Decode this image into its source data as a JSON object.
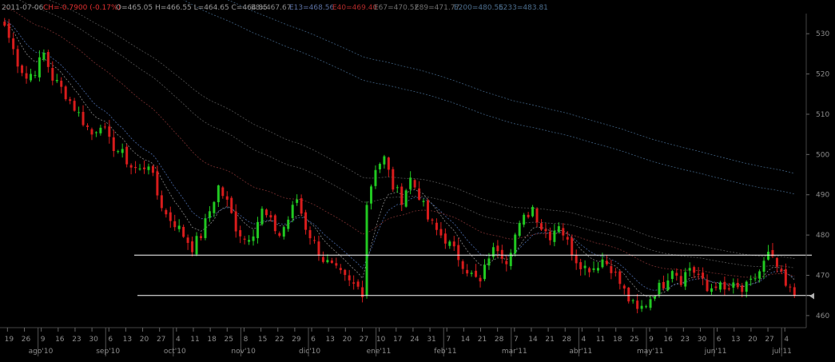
{
  "header": {
    "date": "2011-07-06",
    "change": "CH=-0.7900 (-0.17%)",
    "ohlc": "O=465.05 H=466.55 L=464.65 C=464.85",
    "e8": "E8=467.67",
    "e13": "E13=468.56",
    "e40": "E40=469.40",
    "e67": "E67=470.52",
    "e89": "E89=471.77",
    "e200": "E200=480.55",
    "e233": "E233=483.81"
  },
  "chart_data": {
    "type": "candlestick",
    "ylim": [
      457,
      535
    ],
    "y_ticks": [
      460,
      470,
      480,
      490,
      500,
      510,
      520,
      530
    ],
    "x_day_ticks": [
      "19",
      "26",
      "9",
      "16",
      "23",
      "30",
      "6",
      "13",
      "20",
      "27",
      "4",
      "11",
      "18",
      "25",
      "8",
      "15",
      "22",
      "29",
      "6",
      "13",
      "20",
      "27",
      "10",
      "17",
      "24",
      "31",
      "7",
      "14",
      "21",
      "28",
      "7",
      "14",
      "21",
      "28",
      "4",
      "11",
      "18",
      "25",
      "9",
      "16",
      "23",
      "30",
      "6",
      "13",
      "20",
      "27",
      "4"
    ],
    "x_month_labels": [
      "ago'10",
      "sep'10",
      "oct'10",
      "nov'10",
      "dic'10",
      "ene'11",
      "feb'11",
      "mar'11",
      "abr'11",
      "may'11",
      "jun'11",
      "jul'11"
    ],
    "x_month_tick_index": [
      2,
      6,
      10,
      14,
      18,
      22,
      26,
      30,
      34,
      38,
      42,
      46
    ],
    "last_price": 464.85,
    "horizontal_lines": [
      475,
      465
    ],
    "close_path": [
      [
        0,
        532
      ],
      [
        3,
        523
      ],
      [
        5,
        519
      ],
      [
        7,
        521
      ],
      [
        9,
        525
      ],
      [
        11,
        519
      ],
      [
        14,
        515
      ],
      [
        17,
        510
      ],
      [
        20,
        505
      ],
      [
        22,
        508
      ],
      [
        24,
        503
      ],
      [
        27,
        500
      ],
      [
        29,
        497
      ],
      [
        31,
        496
      ],
      [
        33,
        498
      ],
      [
        35,
        490
      ],
      [
        37,
        485
      ],
      [
        39,
        483
      ],
      [
        41,
        480
      ],
      [
        43,
        477
      ],
      [
        45,
        480
      ],
      [
        47,
        486
      ],
      [
        49,
        492
      ],
      [
        51,
        488
      ],
      [
        53,
        482
      ],
      [
        55,
        479
      ],
      [
        57,
        481
      ],
      [
        59,
        486
      ],
      [
        61,
        483
      ],
      [
        63,
        480
      ],
      [
        65,
        484
      ],
      [
        67,
        489
      ],
      [
        69,
        482
      ],
      [
        71,
        478
      ],
      [
        73,
        474
      ],
      [
        75,
        472
      ],
      [
        77,
        470
      ],
      [
        79,
        468
      ],
      [
        81,
        467
      ],
      [
        82,
        466
      ],
      [
        83,
        488
      ],
      [
        85,
        497
      ],
      [
        87,
        499
      ],
      [
        89,
        492
      ],
      [
        91,
        489
      ],
      [
        93,
        494
      ],
      [
        95,
        490
      ],
      [
        97,
        484
      ],
      [
        99,
        481
      ],
      [
        101,
        479
      ],
      [
        103,
        476
      ],
      [
        105,
        473
      ],
      [
        107,
        470
      ],
      [
        109,
        468
      ],
      [
        111,
        475
      ],
      [
        113,
        477
      ],
      [
        115,
        474
      ],
      [
        117,
        480
      ],
      [
        119,
        484
      ],
      [
        121,
        487
      ],
      [
        123,
        482
      ],
      [
        125,
        480
      ],
      [
        127,
        483
      ],
      [
        129,
        478
      ],
      [
        131,
        474
      ],
      [
        133,
        472
      ],
      [
        135,
        472
      ],
      [
        137,
        474
      ],
      [
        139,
        472
      ],
      [
        141,
        468
      ],
      [
        143,
        464
      ],
      [
        145,
        461
      ],
      [
        147,
        463
      ],
      [
        149,
        466
      ],
      [
        151,
        468
      ],
      [
        153,
        472
      ],
      [
        155,
        469
      ],
      [
        157,
        472
      ],
      [
        159,
        470
      ],
      [
        161,
        466
      ],
      [
        163,
        468
      ],
      [
        165,
        466
      ],
      [
        167,
        467
      ],
      [
        169,
        466
      ],
      [
        171,
        468
      ],
      [
        173,
        471
      ],
      [
        175,
        475
      ],
      [
        177,
        472
      ],
      [
        179,
        467
      ],
      [
        181,
        465
      ]
    ]
  }
}
